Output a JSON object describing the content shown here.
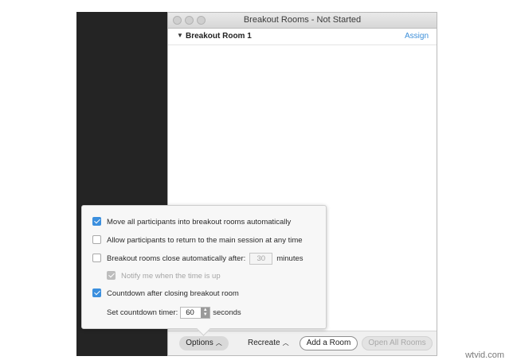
{
  "window": {
    "title": "Breakout Rooms - Not Started"
  },
  "rooms": [
    {
      "name": "Breakout Room 1",
      "assign_label": "Assign"
    }
  ],
  "options_panel": {
    "move_all": {
      "label": "Move all participants into breakout rooms automatically",
      "checked": true
    },
    "allow_return": {
      "label": "Allow participants to return to the main session at any time",
      "checked": false
    },
    "auto_close": {
      "label": "Breakout rooms close automatically after:",
      "value": "30",
      "unit": "minutes",
      "checked": false
    },
    "notify": {
      "label": "Notify me when the time is up",
      "checked": true,
      "disabled": true
    },
    "countdown": {
      "label": "Countdown after closing breakout room",
      "checked": true
    },
    "countdown_timer": {
      "label": "Set countdown timer:",
      "value": "60",
      "unit": "seconds"
    }
  },
  "bottom_bar": {
    "options_label": "Options",
    "recreate_label": "Recreate",
    "add_room_label": "Add a Room",
    "open_all_label": "Open All Rooms"
  },
  "watermark": "wtvid.com",
  "colors": {
    "accent": "#3b8fde",
    "link": "#3d8fd9"
  }
}
